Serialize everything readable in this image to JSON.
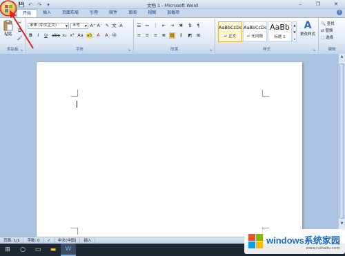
{
  "window": {
    "title": "文档 1 - Microsoft Word",
    "minimize_glyph": "–",
    "maximize_glyph": "❐",
    "close_glyph": "✕"
  },
  "qat": [
    "save-icon",
    "undo-icon",
    "redo-icon",
    "customize-icon"
  ],
  "tabs": [
    {
      "label": "开始",
      "active": true
    },
    {
      "label": "插入"
    },
    {
      "label": "页面布局"
    },
    {
      "label": "引用"
    },
    {
      "label": "邮件"
    },
    {
      "label": "审阅"
    },
    {
      "label": "视图"
    },
    {
      "label": "加载项"
    }
  ],
  "ribbon": {
    "clipboard": {
      "label": "剪贴板",
      "paste": "粘贴"
    },
    "font": {
      "label": "字体",
      "font_name": "宋体 (中文正文)",
      "font_size": "五号",
      "buttons": [
        "B",
        "I",
        "U",
        "abe",
        "x₂",
        "x²",
        "Aa",
        "A"
      ]
    },
    "paragraph": {
      "label": "段落"
    },
    "styles": {
      "label": "样式",
      "items": [
        {
          "preview": "AaBbCcDd",
          "name": "↵ 正文",
          "selected": true
        },
        {
          "preview": "AaBbCcDd",
          "name": "↵ 无间隔"
        },
        {
          "preview": "AaBb",
          "name": "标题 1"
        }
      ],
      "change_styles": "更改样式"
    },
    "editing": {
      "label": "编辑",
      "find": "查找",
      "replace": "替换",
      "select": "选择"
    }
  },
  "status": {
    "page": "页面: 1/1",
    "words": "字数: 0",
    "language": "中文(中国)",
    "mode": "插入"
  },
  "watermark": {
    "brand": "windows系统家园",
    "site": "www.ruihaitu.com"
  },
  "colors": {
    "accent": "#1569c7",
    "annotation": "#e02020"
  }
}
